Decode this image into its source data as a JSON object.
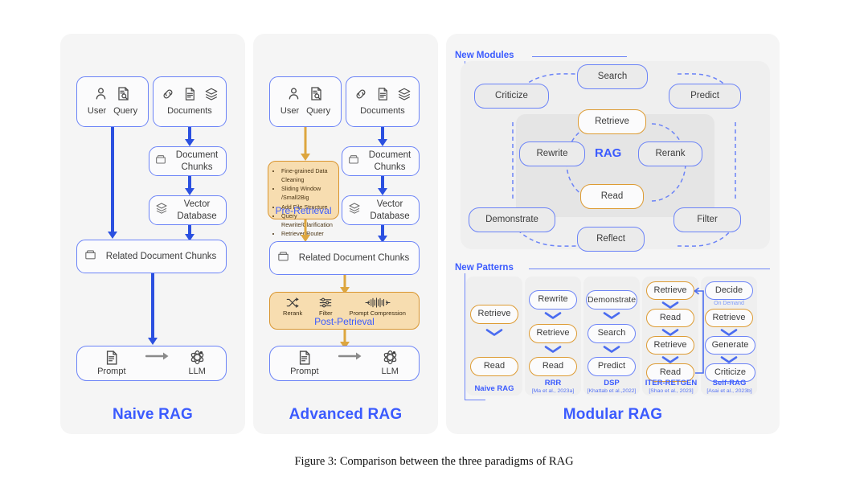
{
  "caption": "Figure 3: Comparison between the three paradigms of RAG",
  "colors": {
    "blue_accent": "#3b5bfe",
    "node_border_blue": "#6b83f7",
    "node_border_amber": "#dd9b33",
    "arrow_blue": "#2b50e0",
    "arrow_amber": "#dda63f",
    "panel_bg": "#f5f5f5",
    "amber_fill": "#f7ddb0",
    "amber_border": "#d9952f"
  },
  "naive": {
    "title": "Naive RAG",
    "user_query": {
      "user": "User",
      "query": "Query",
      "icons": [
        "user-icon",
        "query-document-icon"
      ]
    },
    "documents": {
      "label": "Documents",
      "icons": [
        "link-icon",
        "file-icon",
        "layers-icon"
      ]
    },
    "document_chunks": "Document\nChunks",
    "vector_database": "Vector\nDatabase",
    "related_chunks": "Related Document Chunks",
    "prompt": "Prompt",
    "llm": "LLM"
  },
  "advanced": {
    "title": "Advanced RAG",
    "user_query": {
      "user": "User",
      "query": "Query",
      "icons": [
        "user-icon",
        "query-document-icon"
      ]
    },
    "documents": {
      "label": "Documents",
      "icons": [
        "link-icon",
        "file-icon",
        "layers-icon"
      ]
    },
    "document_chunks": "Document\nChunks",
    "vector_database": "Vector\nDatabase",
    "related_chunks": "Related Document Chunks",
    "pre_retrieval": {
      "tag": "Pre-Retrieval",
      "items": [
        "Fine-grained Data Cleaning",
        "Sliding Window /Small2Big",
        "Add File Structure",
        "Query Rewrite/Clarification",
        "Retriever Router"
      ]
    },
    "post_retrieval": {
      "tag": "Post-Petrieval",
      "items": [
        {
          "label": "Rerank",
          "icon": "shuffle-icon"
        },
        {
          "label": "Filter",
          "icon": "sliders-icon"
        },
        {
          "label": "Prompt Compression",
          "icon": "compress-icon"
        }
      ]
    },
    "prompt": "Prompt",
    "llm": "LLM"
  },
  "modular": {
    "title": "Modular RAG",
    "new_modules_label": "New Modules",
    "new_patterns_label": "New Patterns",
    "rag_core_label": "RAG",
    "modules": [
      {
        "name": "Search",
        "style": "blue"
      },
      {
        "name": "Criticize",
        "style": "blue"
      },
      {
        "name": "Predict",
        "style": "blue"
      },
      {
        "name": "Retrieve",
        "style": "amber"
      },
      {
        "name": "Rewrite",
        "style": "blue"
      },
      {
        "name": "Rerank",
        "style": "blue"
      },
      {
        "name": "Read",
        "style": "amber"
      },
      {
        "name": "Demonstrate",
        "style": "blue"
      },
      {
        "name": "Filter",
        "style": "blue"
      },
      {
        "name": "Reflect",
        "style": "blue"
      }
    ],
    "patterns": [
      {
        "name": "Naive RAG",
        "citation": "",
        "steps": [
          {
            "label": "Retrieve",
            "style": "amber"
          },
          {
            "label": "Read",
            "style": "amber"
          }
        ]
      },
      {
        "name": "RRR",
        "citation": "[Ma et al., 2023a]",
        "steps": [
          {
            "label": "Rewrite",
            "style": "blue"
          },
          {
            "label": "Retrieve",
            "style": "amber"
          },
          {
            "label": "Read",
            "style": "amber"
          }
        ]
      },
      {
        "name": "DSP",
        "citation": "[Khattab et al.,2022]",
        "steps": [
          {
            "label": "Demonstrate",
            "style": "blue"
          },
          {
            "label": "Search",
            "style": "blue"
          },
          {
            "label": "Predict",
            "style": "blue"
          }
        ]
      },
      {
        "name": "ITER-RETGEN",
        "citation": "[Shao et al., 2023]",
        "steps": [
          {
            "label": "Retrieve",
            "style": "amber"
          },
          {
            "label": "Read",
            "style": "amber"
          },
          {
            "label": "Retrieve",
            "style": "amber"
          },
          {
            "label": "Read",
            "style": "amber"
          }
        ]
      },
      {
        "name": "Self-RAG",
        "citation": "[Asai et al., 2023b]",
        "on_demand_note": "On Demand",
        "steps": [
          {
            "label": "Decide",
            "style": "blue"
          },
          {
            "label": "Retrieve",
            "style": "amber"
          },
          {
            "label": "Generate",
            "style": "blue"
          },
          {
            "label": "Criticize",
            "style": "blue"
          }
        ]
      }
    ]
  }
}
